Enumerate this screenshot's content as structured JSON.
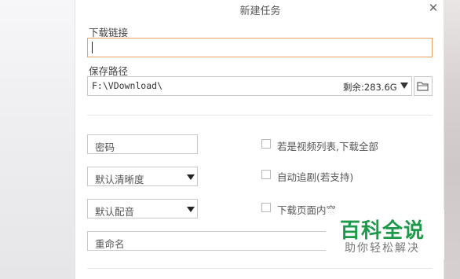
{
  "dialog": {
    "title": "新建任务",
    "close_symbol": "✕"
  },
  "download_link": {
    "label": "下载链接",
    "value": ""
  },
  "save_path": {
    "label": "保存路径",
    "value": "F:\\VDownload\\",
    "free_space": "剩余:283.6G"
  },
  "options": {
    "password_placeholder": "密码",
    "quality_select": "默认清晰度",
    "audio_select": "默认配音",
    "rename_placeholder": "重命名"
  },
  "checkboxes": [
    {
      "label": "若是视频列表,下载全部",
      "checked": false
    },
    {
      "label": "自动追剧(若支持)",
      "checked": false
    },
    {
      "label": "下载页面内容",
      "checked": false
    }
  ],
  "watermark": {
    "title": "百科全说",
    "subtitle": "助你轻松解决"
  },
  "colors": {
    "focus_border": "#f0a060",
    "watermark_green": "#1c9a4a"
  },
  "icons": [
    "close-icon",
    "dropdown-arrow-icon",
    "folder-icon"
  ]
}
